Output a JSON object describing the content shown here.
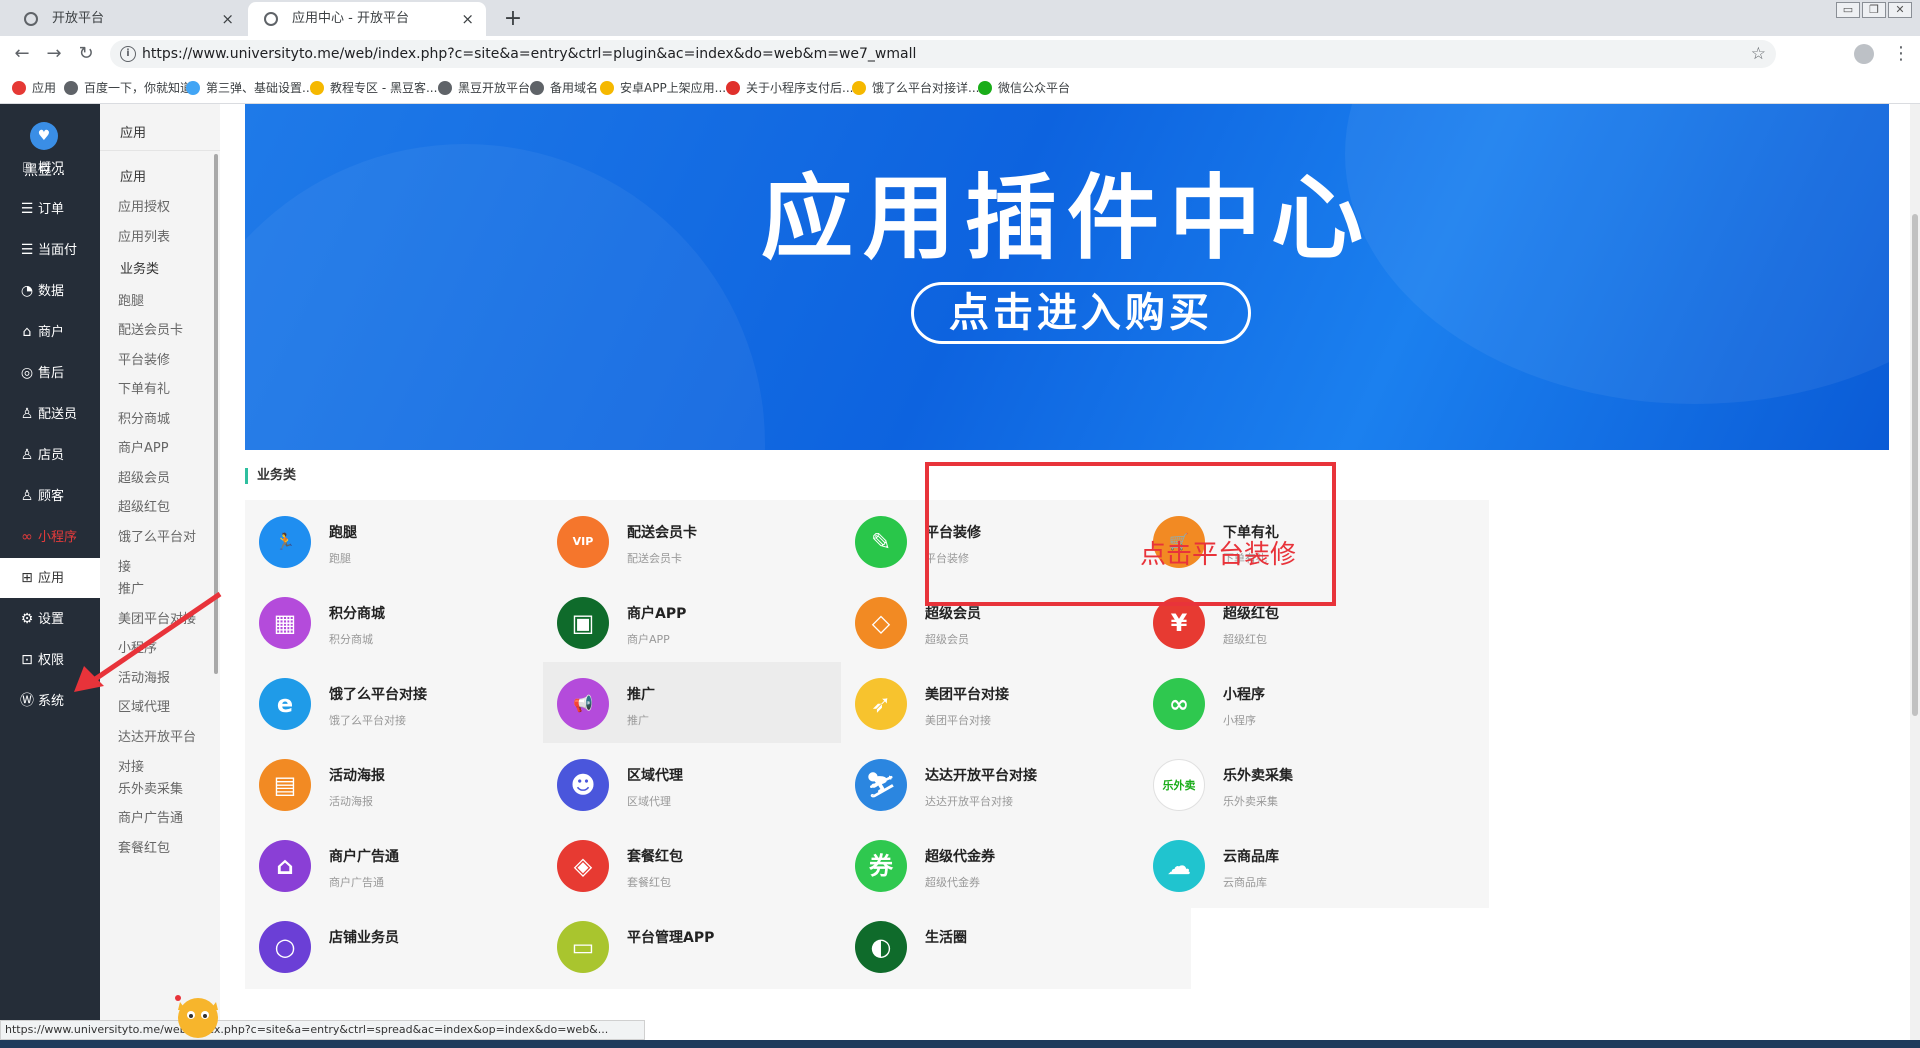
{
  "browser": {
    "tabs": [
      {
        "title": "开放平台",
        "close": "×"
      },
      {
        "title": "应用中心 - 开放平台",
        "close": "×"
      }
    ],
    "new_tab": "+",
    "window_buttons": [
      "▭",
      "❐",
      "✕"
    ],
    "nav": {
      "back": "←",
      "forward": "→",
      "reload": "↻"
    },
    "url": "https://www.universityto.me/web/index.php?c=site&a=entry&ctrl=plugin&ac=index&do=web&m=we7_wmall",
    "bookmark_star": "☆",
    "menu": "⋮",
    "bookmarks": [
      {
        "label": "应用",
        "icon": "apps-icon",
        "color": "#e53935"
      },
      {
        "label": "百度一下，你就知道",
        "icon": "globe-icon",
        "color": "#5f6368"
      },
      {
        "label": "第三弹、基础设置...",
        "icon": "cloud-icon",
        "color": "#42a5f5"
      },
      {
        "label": "教程专区 - 黑豆客...",
        "icon": "trophy-icon",
        "color": "#f5b800"
      },
      {
        "label": "黑豆开放平台",
        "icon": "globe-icon",
        "color": "#5f6368"
      },
      {
        "label": "备用域名",
        "icon": "globe-icon",
        "color": "#5f6368"
      },
      {
        "label": "安卓APP上架应用...",
        "icon": "trophy-icon",
        "color": "#f5b800"
      },
      {
        "label": "关于小程序支付后...",
        "icon": "c-icon",
        "color": "#e0302b"
      },
      {
        "label": "饿了么平台对接详...",
        "icon": "trophy-icon",
        "color": "#f5b800"
      },
      {
        "label": "微信公众平台",
        "icon": "wechat-icon",
        "color": "#1aad19"
      }
    ],
    "status_url": "https://www.universityto.me/web/index.php?c=site&a=entry&ctrl=spread&ac=index&op=index&do=web&..."
  },
  "sidebar": {
    "brand": "黑豆...",
    "items": [
      {
        "label": "概况",
        "icon": "dashboard-icon",
        "glyph": "⌸"
      },
      {
        "label": "订单",
        "icon": "order-icon",
        "glyph": "☰"
      },
      {
        "label": "当面付",
        "icon": "pay-icon",
        "glyph": "☰"
      },
      {
        "label": "数据",
        "icon": "chart-icon",
        "glyph": "◔"
      },
      {
        "label": "商户",
        "icon": "store-icon",
        "glyph": "⌂"
      },
      {
        "label": "售后",
        "icon": "service-icon",
        "glyph": "◎"
      },
      {
        "label": "配送员",
        "icon": "courier-icon",
        "glyph": "♙"
      },
      {
        "label": "店员",
        "icon": "clerk-icon",
        "glyph": "♙"
      },
      {
        "label": "顾客",
        "icon": "customer-icon",
        "glyph": "♙"
      },
      {
        "label": "小程序",
        "icon": "miniapp-icon",
        "glyph": "∞"
      },
      {
        "label": "应用",
        "icon": "apps-icon",
        "glyph": "⊞"
      },
      {
        "label": "设置",
        "icon": "settings-icon",
        "glyph": "⚙"
      },
      {
        "label": "权限",
        "icon": "lock-icon",
        "glyph": "⊡"
      },
      {
        "label": "系统",
        "icon": "system-icon",
        "glyph": "Ⓦ"
      }
    ]
  },
  "submenu": {
    "title": "应用",
    "group1": "应用",
    "group1_items": [
      "应用授权",
      "应用列表"
    ],
    "group2": "业务类",
    "group2_items": [
      "跑腿",
      "配送会员卡",
      "平台装修",
      "下单有礼",
      "积分商城",
      "商户APP",
      "超级会员",
      "超级红包",
      "饿了么平台对",
      "接",
      "推广",
      "美团平台对接",
      "小程序",
      "活动海报",
      "区域代理",
      "达达开放平台",
      "对接",
      "乐外卖采集",
      "商户广告通",
      "套餐红包"
    ]
  },
  "banner": {
    "title": "应用插件中心",
    "button": "点击进入购买"
  },
  "section": {
    "title": "业务类"
  },
  "cards": [
    {
      "name": "跑腿",
      "desc": "跑腿",
      "icon": "run-icon",
      "glyph": "🏃",
      "color": "#1f8ef0"
    },
    {
      "name": "配送会员卡",
      "desc": "配送会员卡",
      "icon": "vip-icon",
      "glyph": "VIP",
      "color": "#f5762c"
    },
    {
      "name": "平台装修",
      "desc": "平台装修",
      "icon": "paint-icon",
      "glyph": "✎",
      "color": "#29c64a"
    },
    {
      "name": "下单有礼",
      "desc": "下单有礼",
      "icon": "cart-icon",
      "glyph": "🛒",
      "color": "#f28a23"
    },
    {
      "name": "积分商城",
      "desc": "积分商城",
      "icon": "gift-icon",
      "glyph": "▦",
      "color": "#b44bdb"
    },
    {
      "name": "商户APP",
      "desc": "商户APP",
      "icon": "grid-icon",
      "glyph": "▣",
      "color": "#0f6b2b"
    },
    {
      "name": "超级会员",
      "desc": "超级会员",
      "icon": "diamond-icon",
      "glyph": "◇",
      "color": "#f28a23"
    },
    {
      "name": "超级红包",
      "desc": "超级红包",
      "icon": "redpacket-icon",
      "glyph": "¥",
      "color": "#e73a32"
    },
    {
      "name": "饿了么平台对接",
      "desc": "饿了么平台对接",
      "icon": "eleme-icon",
      "glyph": "e",
      "color": "#1f9be8"
    },
    {
      "name": "推广",
      "desc": "推广",
      "icon": "megaphone-icon",
      "glyph": "📢",
      "color": "#b44bdb"
    },
    {
      "name": "美团平台对接",
      "desc": "美团平台对接",
      "icon": "kangaroo-icon",
      "glyph": "➶",
      "color": "#f7c32e"
    },
    {
      "name": "小程序",
      "desc": "小程序",
      "icon": "miniprogram-icon",
      "glyph": "∞",
      "color": "#2fc84f"
    },
    {
      "name": "活动海报",
      "desc": "活动海报",
      "icon": "poster-icon",
      "glyph": "▤",
      "color": "#f28a23"
    },
    {
      "name": "区域代理",
      "desc": "区域代理",
      "icon": "group-icon",
      "glyph": "☻",
      "color": "#4a56dc"
    },
    {
      "name": "达达开放平台对接",
      "desc": "达达开放平台对接",
      "icon": "dada-icon",
      "glyph": "⛷",
      "color": "#2b86e0"
    },
    {
      "name": "乐外卖采集",
      "desc": "乐外卖采集",
      "icon": "lewaimai-icon",
      "glyph": "乐外卖",
      "color": "#ffffff"
    },
    {
      "name": "商户广告通",
      "desc": "商户广告通",
      "icon": "shop-ad-icon",
      "glyph": "⌂",
      "color": "#8a3fd6"
    },
    {
      "name": "套餐红包",
      "desc": "套餐红包",
      "icon": "tag-icon",
      "glyph": "◈",
      "color": "#e73a32"
    },
    {
      "name": "超级代金券",
      "desc": "超级代金券",
      "icon": "coupon-icon",
      "glyph": "券",
      "color": "#2fc84f"
    },
    {
      "name": "云商品库",
      "desc": "云商品库",
      "icon": "cloud-icon",
      "glyph": "☁",
      "color": "#20c4cf"
    },
    {
      "name": "店铺业务员",
      "desc": "",
      "icon": "clerk-search-icon",
      "glyph": "○",
      "color": "#6b3fd6"
    },
    {
      "name": "平台管理APP",
      "desc": "",
      "icon": "manage-app-icon",
      "glyph": "▭",
      "color": "#a9c52e"
    },
    {
      "name": "生活圈",
      "desc": "",
      "icon": "life-icon",
      "glyph": "◐",
      "color": "#0f6b2b"
    }
  ],
  "annotation": "点击平台装修",
  "colors": {
    "accent": "#2ebf9f",
    "highlight": "#e8333a",
    "sidebar_bg": "#252d38"
  }
}
